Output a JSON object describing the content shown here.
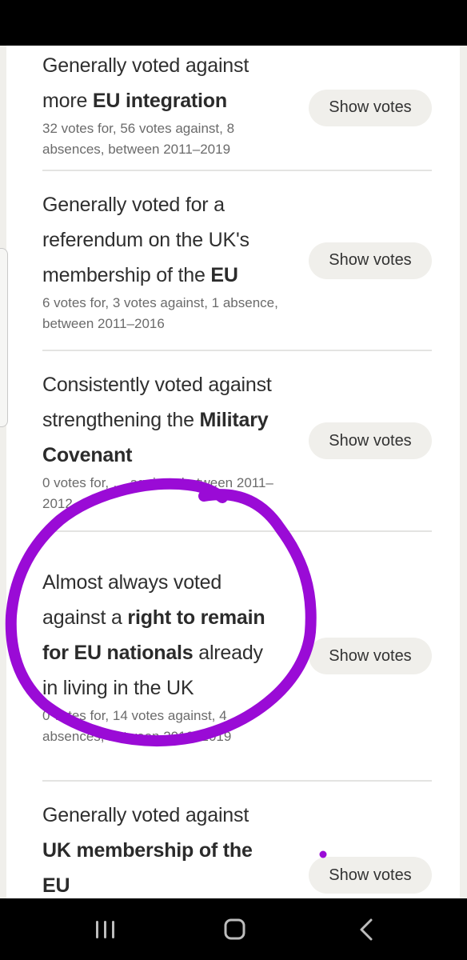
{
  "policies": [
    {
      "title_pre": "Generally voted against more ",
      "title_bold": "EU integration",
      "title_post": "",
      "meta": "32 votes for, 56 votes against, 8 absences, between 2011–2019",
      "button_label": "Show votes"
    },
    {
      "title_pre": "Generally voted for a referendum on the UK's membership of the ",
      "title_bold": "EU",
      "title_post": "",
      "meta": "6 votes for, 3 votes against, 1 absence, between 2011–2016",
      "button_label": "Show votes"
    },
    {
      "title_pre": "Consistently voted against strengthening the ",
      "title_bold": "Military Covenant",
      "title_post": "",
      "meta": "0 votes for, … against, between 2011–2012",
      "button_label": "Show votes"
    },
    {
      "title_pre": "Almost always voted against a ",
      "title_bold": "right to remain for EU nationals",
      "title_post": " already in living in the UK",
      "meta": "0 votes for, 14 votes against, 4 absences, between 2016–2019",
      "button_label": "Show votes"
    },
    {
      "title_pre": "Generally voted against ",
      "title_bold": "UK membership of the EU",
      "title_post": "",
      "meta": "",
      "button_label": "Show votes"
    }
  ],
  "annotation": {
    "type": "hand-drawn circle",
    "target": "right to remain for EU nationals policy",
    "color": "#9a0bd6"
  },
  "nav": {
    "recent_icon": "recent-apps-icon",
    "home_icon": "home-icon",
    "back_icon": "back-icon"
  }
}
